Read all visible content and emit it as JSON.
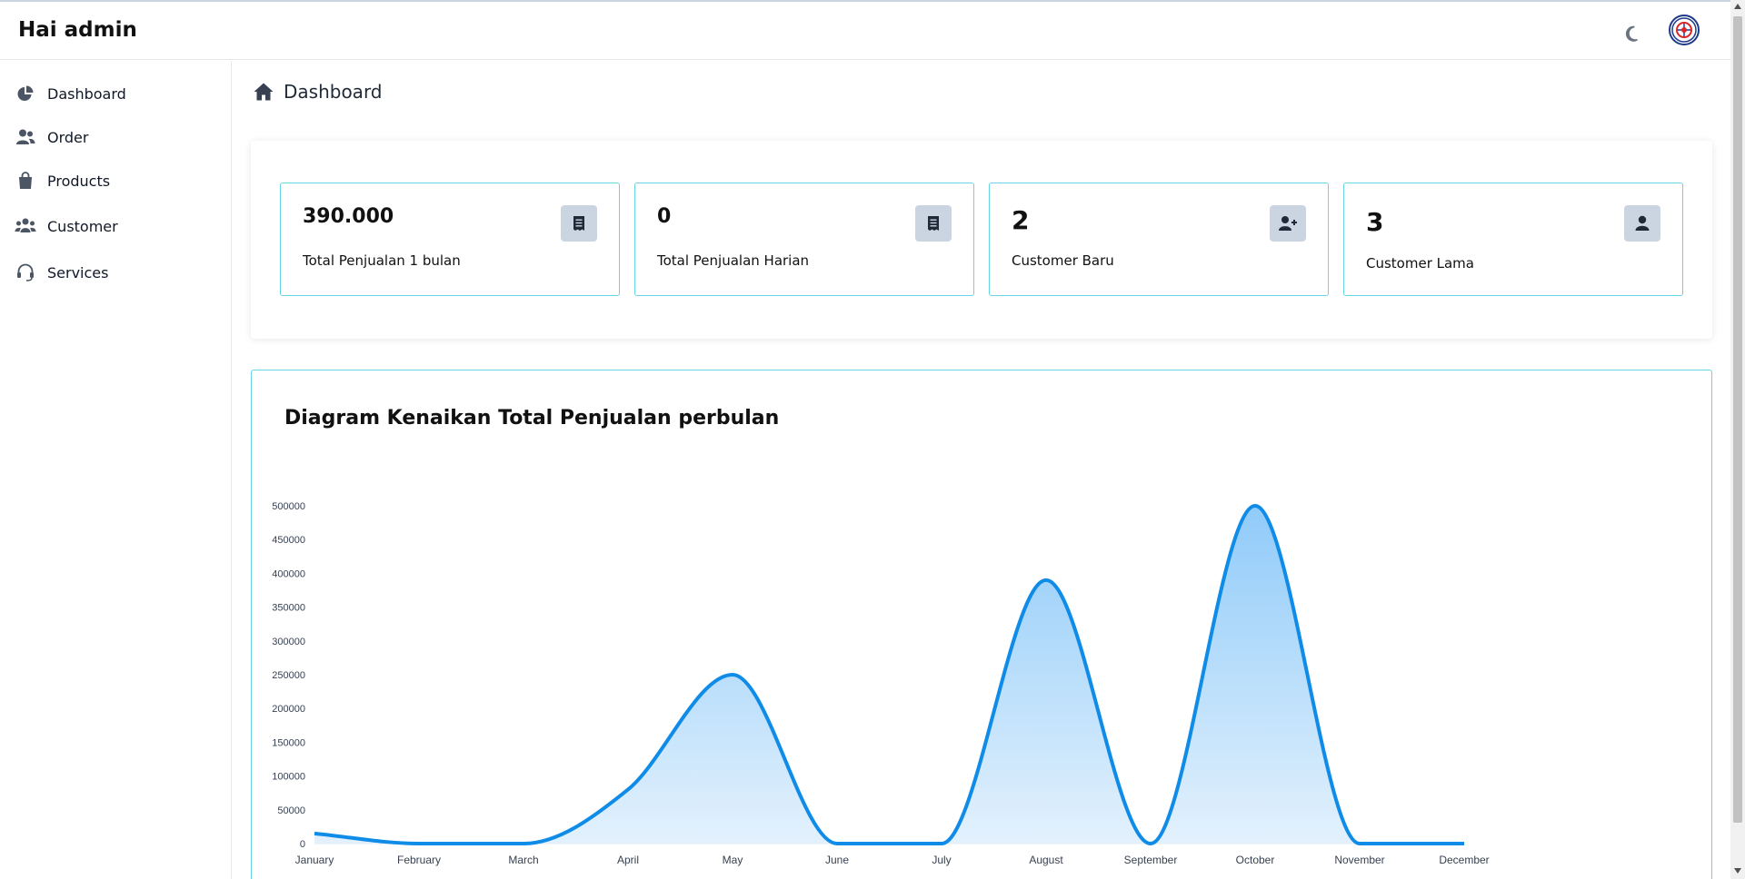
{
  "header": {
    "greeting": "Hai admin",
    "theme_icon": "moon-icon",
    "avatar_icon": "avatar-logo"
  },
  "sidebar": {
    "items": [
      {
        "label": "Dashboard",
        "icon": "chart-pie-icon"
      },
      {
        "label": "Order",
        "icon": "users-icon"
      },
      {
        "label": "Products",
        "icon": "shopping-bag-icon"
      },
      {
        "label": "Customer",
        "icon": "user-group-icon"
      },
      {
        "label": "Services",
        "icon": "headset-icon"
      }
    ]
  },
  "breadcrumb": {
    "label": "Dashboard",
    "icon": "home-icon"
  },
  "stats": [
    {
      "value": "390.000",
      "label": "Total Penjualan 1 bulan",
      "icon": "receipt-icon"
    },
    {
      "value": "0",
      "label": "Total Penjualan Harian",
      "icon": "receipt-icon"
    },
    {
      "value": "2",
      "label": "Customer Baru",
      "icon": "user-plus-icon"
    },
    {
      "value": "3",
      "label": "Customer Lama",
      "icon": "user-icon"
    }
  ],
  "colors": {
    "accent": "#0f8be8",
    "card_border": "#67d5e6",
    "icon_bg": "#cbd5e1",
    "area_fill_top": "#90cbf9",
    "area_fill_bottom": "#e3f1fd"
  },
  "chart_data": {
    "type": "area",
    "title": "Diagram Kenaikan Total Penjualan perbulan",
    "categories": [
      "January",
      "February",
      "March",
      "April",
      "May",
      "June",
      "July",
      "August",
      "September",
      "October",
      "November",
      "December"
    ],
    "values": [
      15000,
      0,
      0,
      80000,
      250000,
      0,
      0,
      390000,
      0,
      500000,
      0,
      0
    ],
    "ylim": [
      0,
      500000
    ],
    "yticks": [
      0,
      50000,
      100000,
      150000,
      200000,
      250000,
      300000,
      350000,
      400000,
      450000,
      500000
    ],
    "xlabel": "",
    "ylabel": "",
    "grid": false,
    "legend": "none"
  }
}
